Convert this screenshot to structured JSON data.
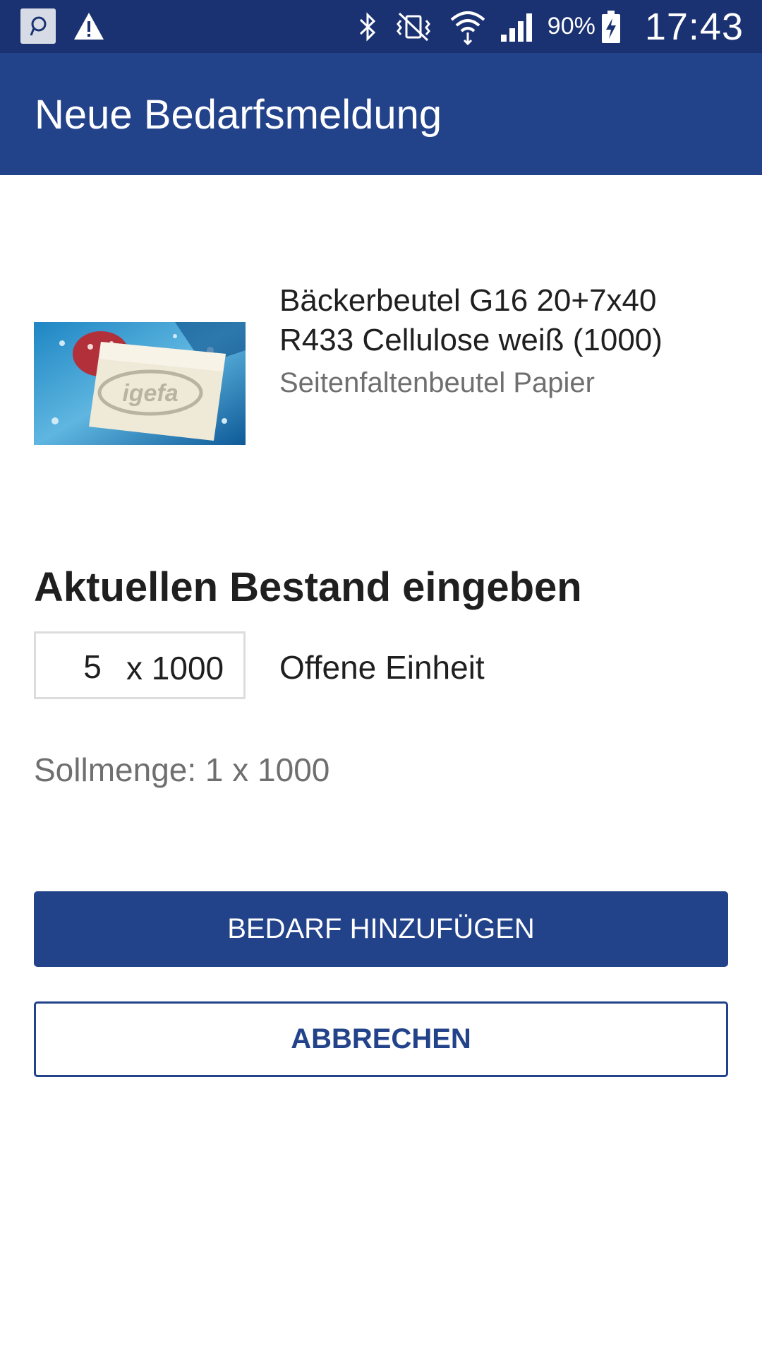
{
  "status_bar": {
    "battery_percent": "90%",
    "time": "17:43",
    "icons": [
      "app-notification-icon",
      "warning-icon",
      "bluetooth-icon",
      "vibrate-icon",
      "wifi-icon",
      "signal-icon",
      "battery-charging-icon"
    ]
  },
  "app_bar": {
    "title": "Neue Bedarfsmeldung"
  },
  "product": {
    "name": "Bäckerbeutel G16 20+7x40 R433 Cellulose weiß (1000)",
    "category": "Seitenfaltenbeutel Papier",
    "image_logo_text": "igefa"
  },
  "stock": {
    "heading": "Aktuellen Bestand eingeben",
    "quantity_value": "5",
    "quantity_unit": "x 1000",
    "unit_label": "Offene Einheit",
    "target_quantity": "Sollmenge: 1 x 1000"
  },
  "actions": {
    "add_label": "BEDARF HINZUFÜGEN",
    "cancel_label": "ABBRECHEN"
  },
  "colors": {
    "status_bar": "#1b3272",
    "primary": "#22428a",
    "text_primary": "#1f1f1f",
    "text_secondary": "#6f6f6f"
  }
}
